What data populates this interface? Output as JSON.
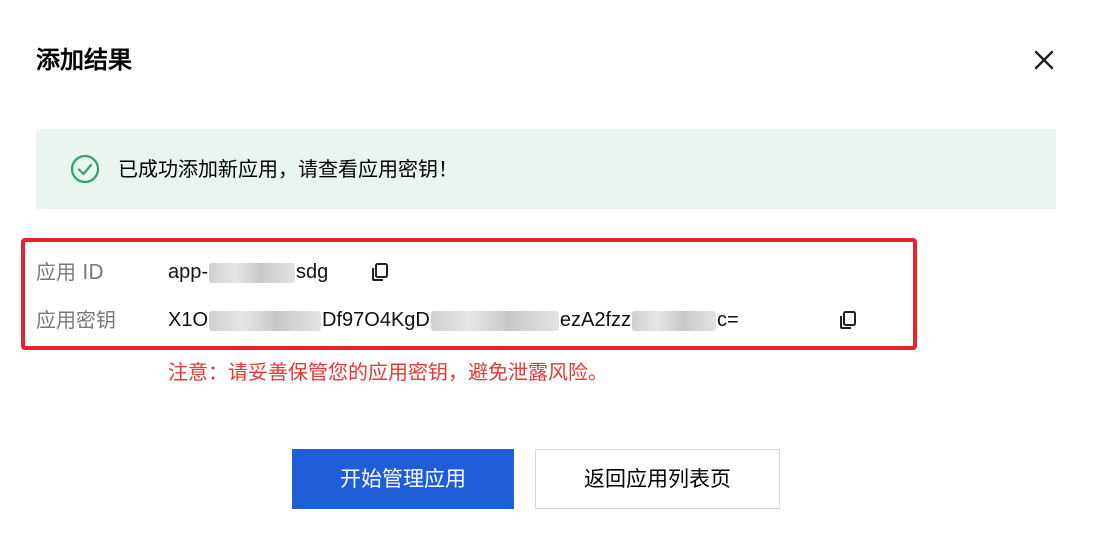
{
  "dialog": {
    "title": "添加结果",
    "close_icon": "close-icon"
  },
  "alert": {
    "icon": "check-circle-icon",
    "message": "已成功添加新应用，请查看应用密钥！",
    "color": "#e9f5ee"
  },
  "credentials": {
    "app_id": {
      "label": "应用 ID",
      "value_prefix": "app-",
      "value_suffix": "sdg",
      "copy_icon": "copy-icon"
    },
    "app_secret": {
      "label": "应用密钥",
      "value_part1": "X1O",
      "value_part2": "Df97O4KgD",
      "value_part3": "ezA2fzz",
      "value_part4": "c=",
      "copy_icon": "copy-icon"
    },
    "highlight_color": "#e8212b"
  },
  "warning": {
    "text": "注意：请妥善保管您的应用密钥，避免泄露风险。",
    "color": "#e53935"
  },
  "buttons": {
    "primary": {
      "label": "开始管理应用",
      "color": "#1f5ed8"
    },
    "secondary": {
      "label": "返回应用列表页"
    }
  }
}
